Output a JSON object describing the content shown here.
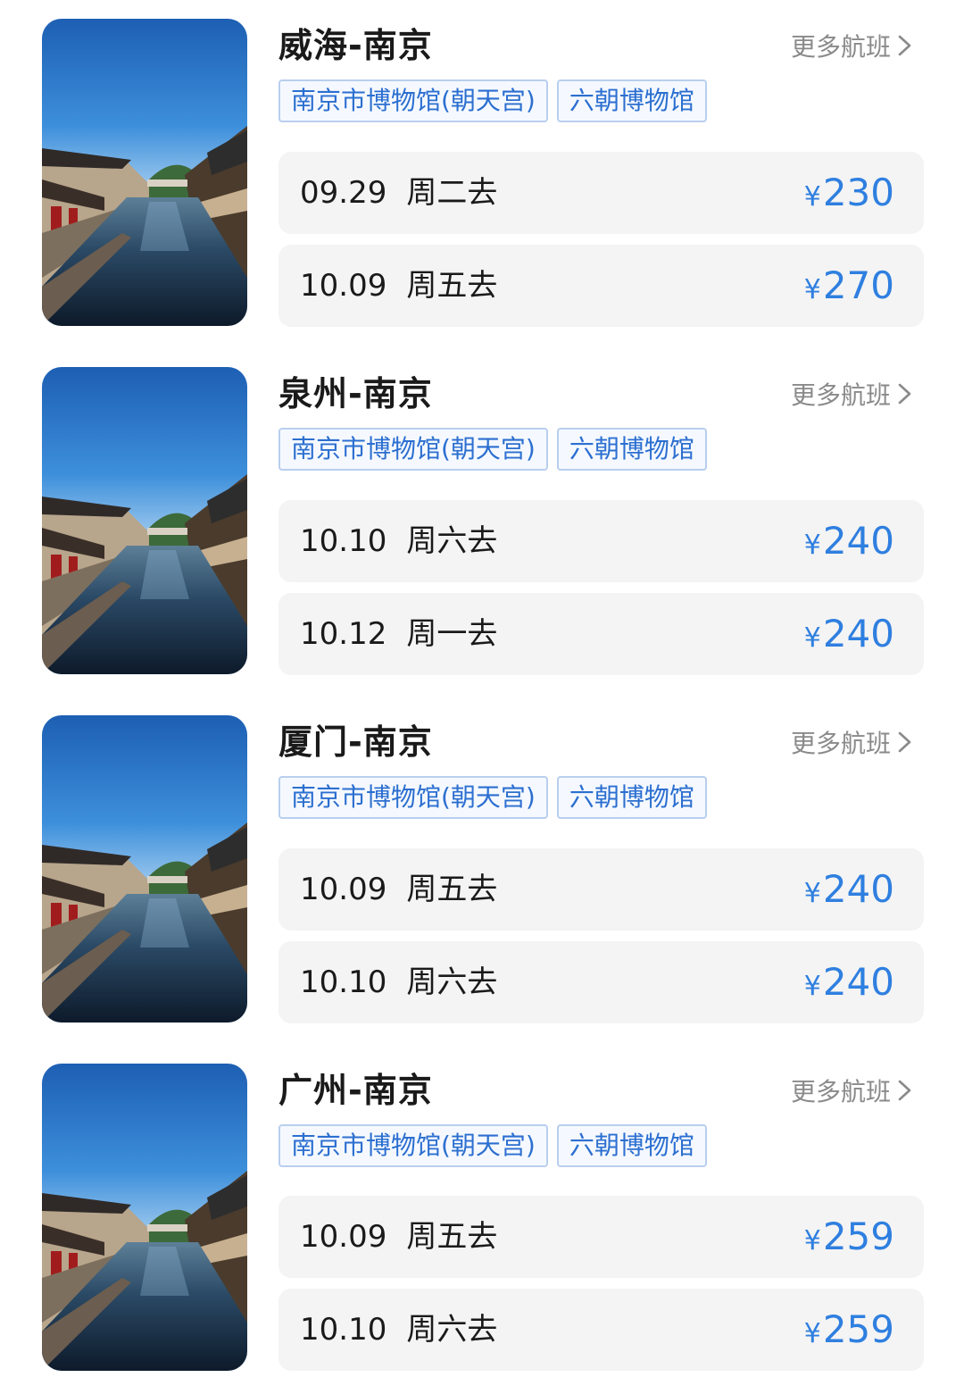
{
  "colors": {
    "accent": "#2f7fe0",
    "tag_border": "#b9cfee",
    "row_bg": "#f4f4f4",
    "muted": "#8a8a8a"
  },
  "cards": [
    {
      "route": "威海-南京",
      "more_label": "更多航班",
      "tags": [
        "南京市博物馆(朝天宫)",
        "六朝博物馆"
      ],
      "flights": [
        {
          "date": "09.29",
          "day": "周二去",
          "currency": "¥",
          "price": "230"
        },
        {
          "date": "10.09",
          "day": "周五去",
          "currency": "¥",
          "price": "270"
        }
      ]
    },
    {
      "route": "泉州-南京",
      "more_label": "更多航班",
      "tags": [
        "南京市博物馆(朝天宫)",
        "六朝博物馆"
      ],
      "flights": [
        {
          "date": "10.10",
          "day": "周六去",
          "currency": "¥",
          "price": "240"
        },
        {
          "date": "10.12",
          "day": "周一去",
          "currency": "¥",
          "price": "240"
        }
      ]
    },
    {
      "route": "厦门-南京",
      "more_label": "更多航班",
      "tags": [
        "南京市博物馆(朝天宫)",
        "六朝博物馆"
      ],
      "flights": [
        {
          "date": "10.09",
          "day": "周五去",
          "currency": "¥",
          "price": "240"
        },
        {
          "date": "10.10",
          "day": "周六去",
          "currency": "¥",
          "price": "240"
        }
      ]
    },
    {
      "route": "广州-南京",
      "more_label": "更多航班",
      "tags": [
        "南京市博物馆(朝天宫)",
        "六朝博物馆"
      ],
      "flights": [
        {
          "date": "10.09",
          "day": "周五去",
          "currency": "¥",
          "price": "259"
        },
        {
          "date": "10.10",
          "day": "周六去",
          "currency": "¥",
          "price": "259"
        }
      ]
    }
  ]
}
